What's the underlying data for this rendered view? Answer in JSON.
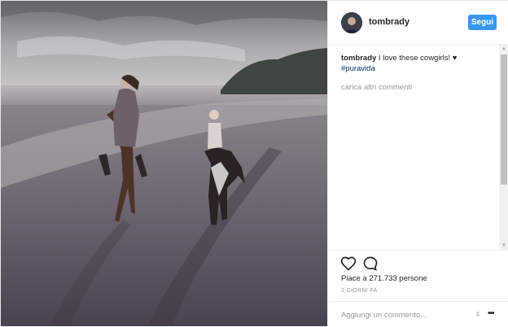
{
  "post": {
    "username": "tombrady",
    "follow_label": "Segui",
    "caption_user": "tombrady",
    "caption_text": " I love these cowgirls! ♥",
    "hashtag": "#puravida",
    "load_more": "carica altri commenti",
    "likes": "Piace a 271.733 persone",
    "date": "2 GIORNI FA",
    "comment_placeholder": "Aggiungi un commento..."
  },
  "colors": {
    "follow": "#3897f0",
    "hashtag": "#003569",
    "muted": "#999999"
  },
  "icons": {
    "heart": "heart-icon",
    "comment": "comment-bubble-icon",
    "more": "more-options-icon",
    "resize": "resize-icon"
  },
  "photo": {
    "description_alt": "photo"
  }
}
